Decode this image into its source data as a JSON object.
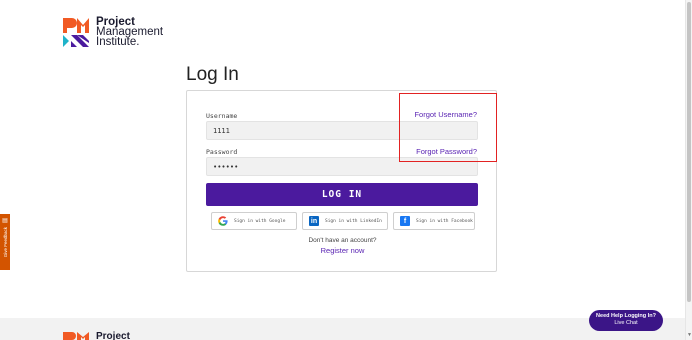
{
  "brand": {
    "line1": "Project",
    "line2": "Management",
    "line3": "Institute.",
    "colors": {
      "orange": "#f15a24",
      "purple": "#4b1a9e",
      "teal": "#1fb3c9"
    }
  },
  "page_title": "Log In",
  "form": {
    "username_label": "Username",
    "username_value": "1111",
    "forgot_username": "Forgot Username?",
    "password_label": "Password",
    "password_value": "••••••",
    "forgot_password": "Forgot Password?",
    "login_button": "LOG IN"
  },
  "social": {
    "google": {
      "label": "Sign in with Google",
      "icon": "google-icon"
    },
    "linkedin": {
      "label": "Sign in with LinkedIn",
      "icon": "linkedin-icon"
    },
    "facebook": {
      "label": "Sign in with Facebook",
      "icon": "facebook-icon"
    }
  },
  "register": {
    "prompt": "Don't have an account?",
    "link": "Register now"
  },
  "feedback_tab": "Give Feedback",
  "help_bubble": {
    "title": "Need Help Logging In?",
    "subtitle": "Live Chat"
  },
  "footer": {
    "brand": "Project"
  },
  "accent_colors": {
    "highlight_box": "#e22222",
    "link": "#5a24b3",
    "button": "#4b1a9e"
  }
}
